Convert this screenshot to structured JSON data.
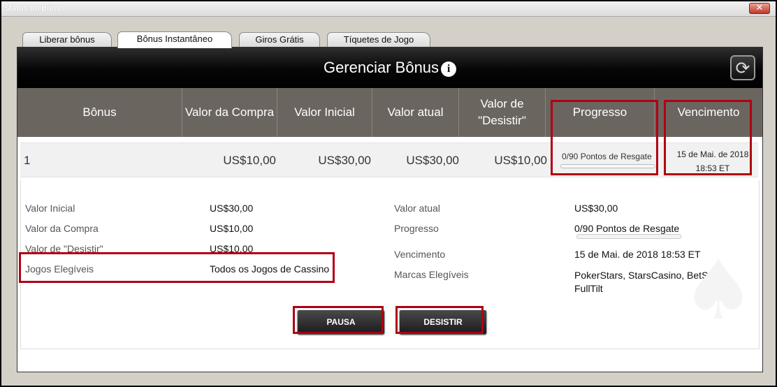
{
  "window": {
    "title": "Status do Bônus",
    "close_label": "✕"
  },
  "tabs": [
    {
      "label": "Liberar bônus"
    },
    {
      "label": "Bônus Instantâneo"
    },
    {
      "label": "Giros Grátis"
    },
    {
      "label": "Tíquetes de Jogo"
    }
  ],
  "header": {
    "title": "Gerenciar Bônus",
    "info_icon": "i",
    "refresh_icon": "⟳"
  },
  "columns": [
    {
      "label": "Bônus"
    },
    {
      "label": "Valor da Compra"
    },
    {
      "label": "Valor Inicial"
    },
    {
      "label": "Valor atual"
    },
    {
      "label": "Valor de \"Desistir\""
    },
    {
      "label": "Progresso"
    },
    {
      "label": "Vencimento"
    }
  ],
  "bonus_row": {
    "id": "1",
    "purchase_value": "US$10,00",
    "initial_value": "US$30,00",
    "current_value": "US$30,00",
    "forfeit_value": "US$10,00",
    "progress_text": "0/90 Pontos de Resgate",
    "progress_fraction": 0,
    "expiry_line1": "15 de Mai. de 2018",
    "expiry_line2": "18:53 ET"
  },
  "details": {
    "left": [
      {
        "label": "Valor Inicial",
        "value": "US$30,00"
      },
      {
        "label": "Valor da Compra",
        "value": "US$10,00"
      },
      {
        "label": "Valor de \"Desistir\"",
        "value": "US$10,00"
      },
      {
        "label": "Jogos Elegíveis",
        "value": "Todos os Jogos de Cassino"
      }
    ],
    "right": [
      {
        "label": "Valor atual",
        "value": "US$30,00"
      },
      {
        "label": "Progresso",
        "value": "0/90 Pontos de Resgate"
      },
      {
        "label": "Vencimento",
        "value": "15 de Mai. de 2018 18:53 ET"
      },
      {
        "label": "Marcas Elegíveis",
        "value_line1": "PokerStars, StarsCasino, BetStars,",
        "value_line2": "FullTilt"
      }
    ]
  },
  "buttons": {
    "pause": "PAUSA",
    "forfeit": "DESISTIR"
  },
  "colors": {
    "highlight": "#b00012",
    "header_bg": "#6b6560",
    "progress_fill": "#3a8a2c"
  }
}
